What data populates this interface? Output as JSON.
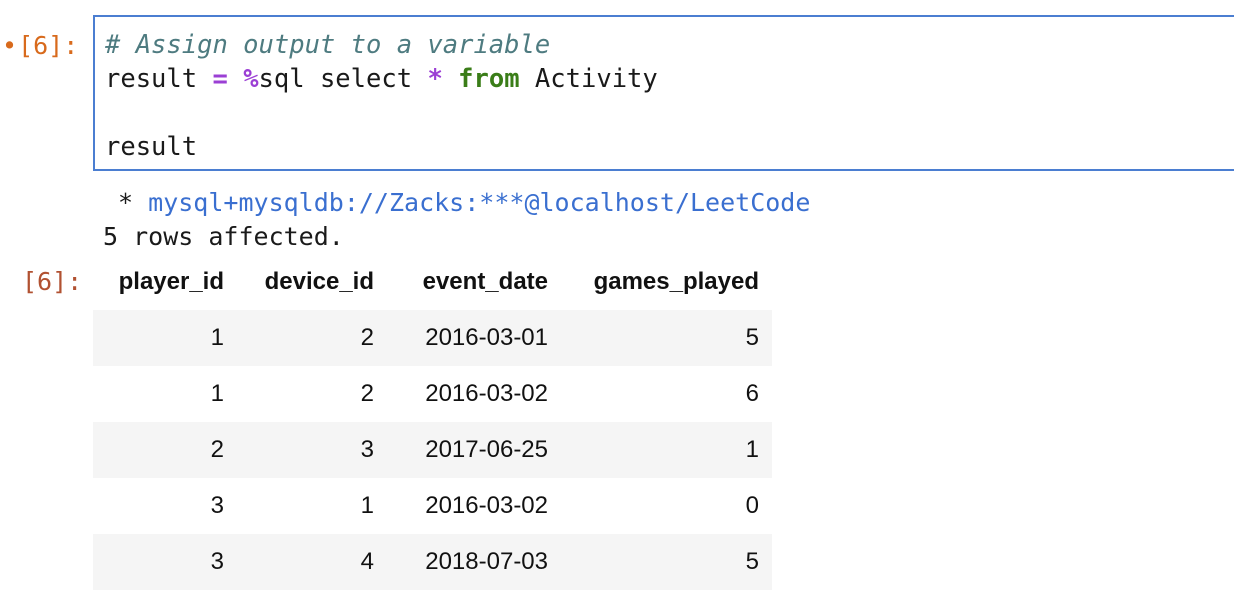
{
  "input_cell": {
    "prompt": "[6]:",
    "dirty_marker": "•",
    "code_lines": [
      {
        "parts": [
          {
            "text": "# Assign output to a variable",
            "kind": "comment"
          }
        ]
      },
      {
        "parts": [
          {
            "text": "result ",
            "kind": "plain"
          },
          {
            "text": "=",
            "kind": "op"
          },
          {
            "text": " ",
            "kind": "plain"
          },
          {
            "text": "%",
            "kind": "op"
          },
          {
            "text": "sql select ",
            "kind": "plain"
          },
          {
            "text": "*",
            "kind": "op"
          },
          {
            "text": " ",
            "kind": "plain"
          },
          {
            "text": "from",
            "kind": "kw"
          },
          {
            "text": " Activity",
            "kind": "plain"
          }
        ]
      },
      {
        "parts": [
          {
            "text": "",
            "kind": "plain"
          }
        ]
      },
      {
        "parts": [
          {
            "text": "result",
            "kind": "plain"
          }
        ]
      }
    ]
  },
  "output": {
    "connection_prefix": " * ",
    "connection_url": "mysql+mysqldb://Zacks:***@localhost/LeetCode",
    "rows_message": "5 rows affected.",
    "prompt": "[6]:"
  },
  "table": {
    "columns": [
      "player_id",
      "device_id",
      "event_date",
      "games_played"
    ],
    "rows": [
      [
        "1",
        "2",
        "2016-03-01",
        "5"
      ],
      [
        "1",
        "2",
        "2016-03-02",
        "6"
      ],
      [
        "2",
        "3",
        "2017-06-25",
        "1"
      ],
      [
        "3",
        "1",
        "2016-03-02",
        "0"
      ],
      [
        "3",
        "4",
        "2018-07-03",
        "5"
      ]
    ]
  },
  "colors": {
    "in_prompt": "#d86a1c",
    "out_prompt": "#b15131",
    "active_border": "#4b7ed1",
    "comment": "#4e7b80",
    "operator": "#9b3fd4",
    "keyword": "#3a7d18",
    "url": "#3a6fd0"
  }
}
